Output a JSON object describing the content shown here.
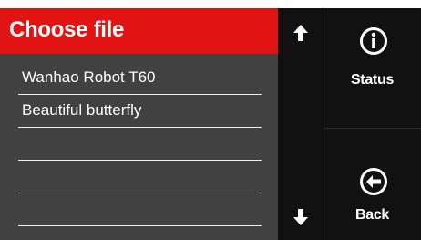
{
  "header": {
    "title": "Choose file"
  },
  "file_list": {
    "items": [
      {
        "label": "Wanhao Robot T60"
      },
      {
        "label": "Beautiful butterfly"
      },
      {
        "label": ""
      },
      {
        "label": ""
      },
      {
        "label": ""
      }
    ]
  },
  "scroll": {
    "up_icon": "arrow-up-icon",
    "down_icon": "arrow-down-icon"
  },
  "actions": {
    "status_label": "Status",
    "status_icon": "info-circle-icon",
    "back_label": "Back",
    "back_icon": "arrow-left-circle-icon"
  },
  "colors": {
    "header_red": "#e11313",
    "list_bg": "#414141",
    "side_bg": "#111111",
    "text": "#ffffff"
  }
}
